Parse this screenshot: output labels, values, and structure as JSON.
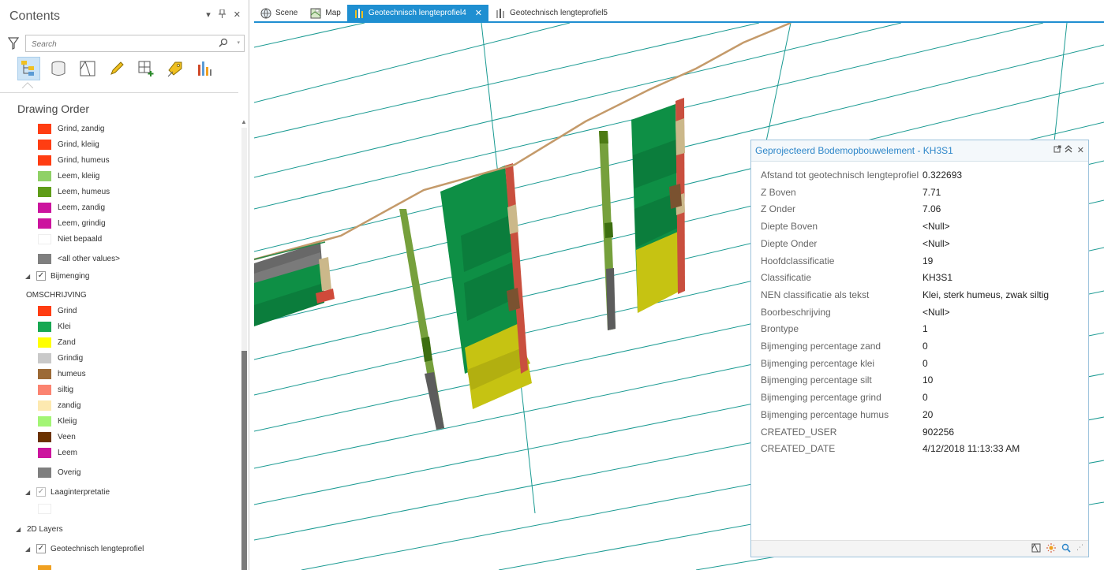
{
  "contents": {
    "title": "Contents",
    "search_placeholder": "Search",
    "section_title": "Drawing Order",
    "classes_a": [
      {
        "label": "Grind, zandig",
        "color": "#ff3d12"
      },
      {
        "label": "Grind, kleiig",
        "color": "#ff3d12"
      },
      {
        "label": "Grind, humeus",
        "color": "#ff3d12"
      },
      {
        "label": "Leem, kleiig",
        "color": "#8fd166"
      },
      {
        "label": "Leem, humeus",
        "color": "#5f9c18"
      },
      {
        "label": "Leem, zandig",
        "color": "#cc149e"
      },
      {
        "label": "Leem, grindig",
        "color": "#cc149e"
      },
      {
        "label": "Niet bepaald",
        "color": "#ffffff"
      },
      {
        "label": "<all other values>",
        "color": "#7f7f7f"
      }
    ],
    "group_bijmenging": "Bijmenging",
    "field_header": "OMSCHRIJVING",
    "classes_b": [
      {
        "label": "Grind",
        "color": "#ff3d12"
      },
      {
        "label": "Klei",
        "color": "#17a852"
      },
      {
        "label": "Zand",
        "color": "#ffff00"
      },
      {
        "label": "Grindig",
        "color": "#c9c9c9"
      },
      {
        "label": "humeus",
        "color": "#9c6a36"
      },
      {
        "label": "siltig",
        "color": "#fb8370"
      },
      {
        "label": "zandig",
        "color": "#fde9b0"
      },
      {
        "label": "Kleiig",
        "color": "#a3f575"
      },
      {
        "label": "Veen",
        "color": "#6b3200"
      },
      {
        "label": "Leem",
        "color": "#cc149e"
      },
      {
        "label": "Overig",
        "color": "#7f7f7f"
      }
    ],
    "group_laag": "Laaginterpretatie",
    "section_2d": "2D Layers",
    "group_geo": "Geotechnisch lengteprofiel"
  },
  "tabs": [
    {
      "label": "Scene",
      "icon": "globe-icon"
    },
    {
      "label": "Map",
      "icon": "map-icon"
    },
    {
      "label": "Geotechnisch lengteprofiel4",
      "icon": "profile-icon",
      "active": true
    },
    {
      "label": "Geotechnisch lengteprofiel5",
      "icon": "profile-icon"
    }
  ],
  "popup": {
    "title": "Geprojecteerd Bodemopbouwelement - KH3S1",
    "fields": [
      {
        "key": "Afstand tot geotechnisch lengteprofiel",
        "value": "0.322693"
      },
      {
        "key": "Z Boven",
        "value": "7.71"
      },
      {
        "key": "Z Onder",
        "value": "7.06"
      },
      {
        "key": "Diepte Boven",
        "value": "<Null>"
      },
      {
        "key": "Diepte Onder",
        "value": "<Null>"
      },
      {
        "key": "Hoofdclassificatie",
        "value": "19"
      },
      {
        "key": "Classificatie",
        "value": "KH3S1"
      },
      {
        "key": "NEN classificatie als tekst",
        "value": "Klei, sterk humeus, zwak siltig"
      },
      {
        "key": "Boorbeschrijving",
        "value": "<Null>"
      },
      {
        "key": "Brontype",
        "value": "1"
      },
      {
        "key": "Bijmenging percentage zand",
        "value": "0"
      },
      {
        "key": "Bijmenging percentage klei",
        "value": "0"
      },
      {
        "key": "Bijmenging percentage silt",
        "value": "10"
      },
      {
        "key": "Bijmenging percentage grind",
        "value": "0"
      },
      {
        "key": "Bijmenging percentage humus",
        "value": "20"
      },
      {
        "key": "CREATED_USER",
        "value": "902256"
      },
      {
        "key": "CREATED_DATE",
        "value": "4/12/2018 11:13:33 AM"
      }
    ]
  },
  "colors": {
    "accent": "#1f8fd1",
    "grid_line": "#1a9a92",
    "surface_line": "#c49a6a"
  }
}
